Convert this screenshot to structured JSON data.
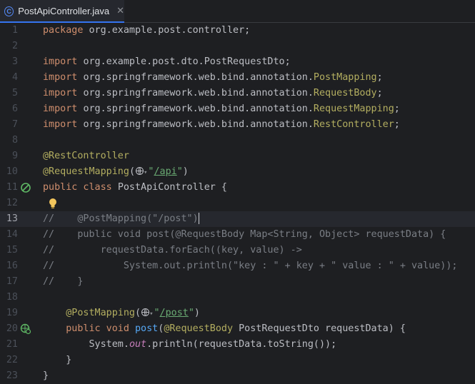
{
  "tab": {
    "label": "PostApiController.java",
    "icon": "java-class-icon",
    "close": "✕"
  },
  "lines": [
    {
      "n": "1",
      "t": [
        [
          "kw",
          "package"
        ],
        [
          "",
          "org.example.post.controller;"
        ]
      ]
    },
    {
      "n": "2",
      "t": []
    },
    {
      "n": "3",
      "t": [
        [
          "kw",
          "import"
        ],
        [
          "",
          "org.example.post.dto.PostRequestDto;"
        ]
      ]
    },
    {
      "n": "4",
      "t": [
        [
          "kw",
          "import"
        ],
        [
          "",
          "org.springframework.web.bind.annotation."
        ],
        [
          "ann",
          "PostMapping"
        ],
        [
          "",
          ";"
        ]
      ]
    },
    {
      "n": "5",
      "t": [
        [
          "kw",
          "import"
        ],
        [
          "",
          "org.springframework.web.bind.annotation."
        ],
        [
          "ann",
          "RequestBody"
        ],
        [
          "",
          ";"
        ]
      ]
    },
    {
      "n": "6",
      "t": [
        [
          "kw",
          "import"
        ],
        [
          "",
          "org.springframework.web.bind.annotation."
        ],
        [
          "ann",
          "RequestMapping"
        ],
        [
          "",
          ";"
        ]
      ]
    },
    {
      "n": "7",
      "t": [
        [
          "kw",
          "import"
        ],
        [
          "",
          "org.springframework.web.bind.annotation."
        ],
        [
          "ann",
          "RestController"
        ],
        [
          "",
          ";"
        ]
      ]
    },
    {
      "n": "8",
      "t": []
    },
    {
      "n": "9",
      "t": [
        [
          "ann",
          "@RestController"
        ]
      ]
    },
    {
      "n": "10",
      "t": [
        [
          "ann",
          "@RequestMapping"
        ],
        [
          "",
          "("
        ],
        [
          "globe",
          ""
        ],
        [
          "str",
          "\""
        ],
        [
          "str-link",
          "/api"
        ],
        [
          "str",
          "\""
        ],
        [
          "",
          ")"
        ]
      ]
    },
    {
      "n": "11",
      "t": [
        [
          "kw",
          "public class "
        ],
        [
          "",
          "PostApiController {"
        ]
      ]
    },
    {
      "n": "12",
      "t": []
    },
    {
      "n": "13",
      "t": [
        [
          "cmt",
          "//    @PostMapping(\"/post\")"
        ],
        [
          "caret",
          ""
        ]
      ]
    },
    {
      "n": "14",
      "t": [
        [
          "cmt",
          "//    public void post(@RequestBody Map<String, Object> requestData) {"
        ]
      ]
    },
    {
      "n": "15",
      "t": [
        [
          "cmt",
          "//        requestData.forEach((key, value) ->"
        ]
      ]
    },
    {
      "n": "16",
      "t": [
        [
          "cmt",
          "//            System.out.println(\"key : \" + key + \" value : \" + value));"
        ]
      ]
    },
    {
      "n": "17",
      "t": [
        [
          "cmt",
          "//    }"
        ]
      ]
    },
    {
      "n": "18",
      "t": []
    },
    {
      "n": "19",
      "t": [
        [
          "",
          "    "
        ],
        [
          "ann",
          "@PostMapping"
        ],
        [
          "",
          "("
        ],
        [
          "globe",
          ""
        ],
        [
          "str",
          "\""
        ],
        [
          "str-link",
          "/post"
        ],
        [
          "str",
          "\""
        ],
        [
          "",
          ")"
        ]
      ]
    },
    {
      "n": "20",
      "t": [
        [
          "kw",
          "    public void "
        ],
        [
          "fn",
          "post"
        ],
        [
          "",
          "("
        ],
        [
          "ann",
          "@RequestBody "
        ],
        [
          "",
          "PostRequestDto requestData) {"
        ]
      ]
    },
    {
      "n": "21",
      "t": [
        [
          "",
          "        System."
        ],
        [
          "static",
          "out"
        ],
        [
          "",
          ".println(requestData.toString());"
        ]
      ]
    },
    {
      "n": "22",
      "t": [
        [
          "",
          "    }"
        ]
      ]
    },
    {
      "n": "23",
      "t": [
        [
          "",
          "}"
        ]
      ]
    }
  ],
  "current_line": "13",
  "gutter_icons": [
    {
      "line": "11",
      "icon": "spring-bean-icon"
    },
    {
      "line": "20",
      "icon": "spring-web-endpoint-icon"
    }
  ],
  "intention_bulb": {
    "line": "12",
    "icon": "lightbulb-icon"
  }
}
